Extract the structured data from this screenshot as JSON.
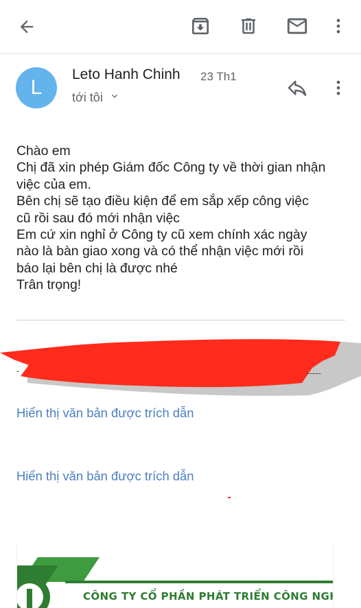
{
  "toolbar": {
    "back_icon": "arrow-back-icon",
    "archive_icon": "archive-icon",
    "delete_icon": "trash-icon",
    "mark_unread_icon": "mail-icon",
    "more_icon": "more-vert-icon"
  },
  "message": {
    "avatar_letter": "L",
    "avatar_color": "#63b3ed",
    "sender": "Leto Hanh Chinh",
    "date": "23 Th1",
    "recipient": "tới tôi",
    "body_lines": [
      "Chào em",
      "Chị đã xin phép Giám đốc Công ty về thời gian nhận",
      "việc của em.",
      "Bên chị sẽ tạo điều kiện để em sắp xếp công việc",
      "cũ rồi sau đó mới nhận việc",
      "Em cứ xin nghỉ ở Công ty cũ xem chính xác ngày",
      "nào là bàn giao xong và có thể nhận việc mới rồi",
      "báo lại bên chị là được nhé",
      "Trân trọng!"
    ]
  },
  "quoted": {
    "link1": "Hiển thị văn bản được trích dẫn",
    "link2": "Hiển thị văn bản được trích dẫn"
  },
  "signature": {
    "company": "CÔNG TY CỔ PHẦN PHÁT TRIỂN CÔNG NGHỆ LETO"
  },
  "colors": {
    "link": "#4a7fc1",
    "redaction": "#ff2b1c",
    "logo_green": "#2e7d32"
  }
}
